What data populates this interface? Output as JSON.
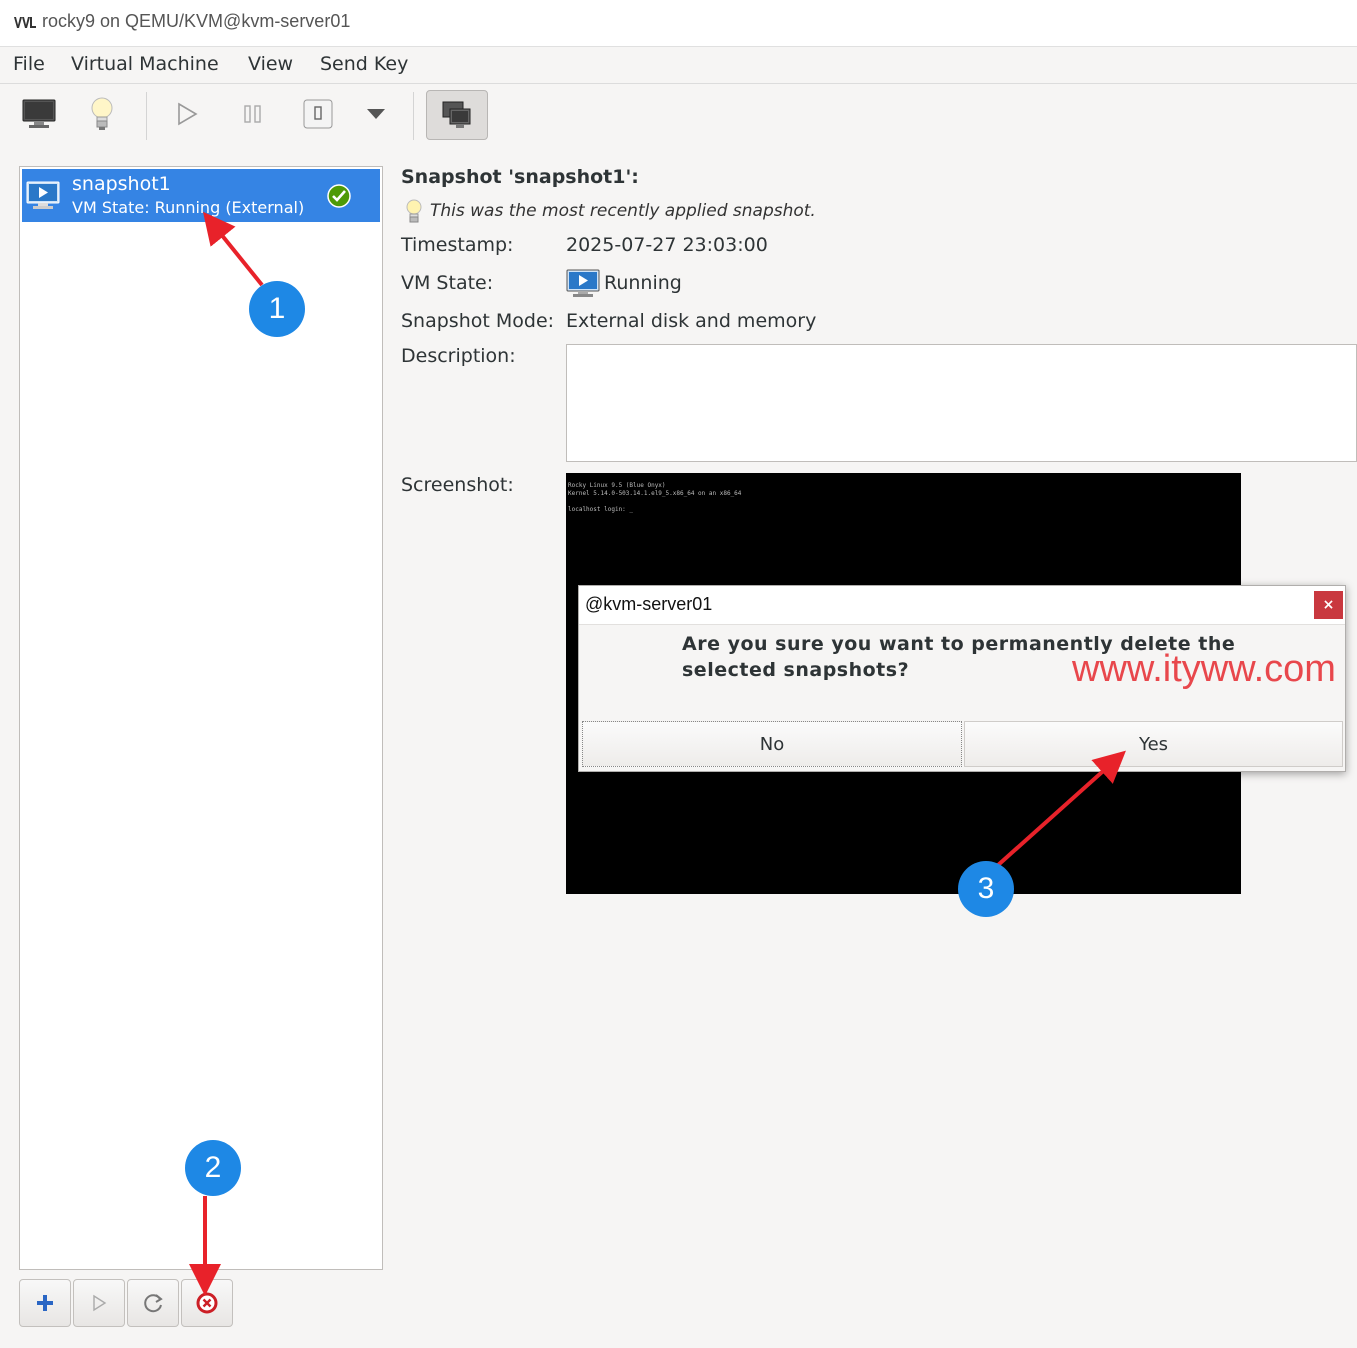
{
  "window": {
    "title": "rocky9 on QEMU/KVM@kvm-server01"
  },
  "menubar": {
    "items": [
      "File",
      "Virtual Machine",
      "View",
      "Send Key"
    ]
  },
  "toolbar": {
    "buttons": [
      "monitor-icon",
      "lightbulb-icon",
      "play-icon",
      "pause-icon",
      "power-icon",
      "dropdown-arrow-icon",
      "snapshots-icon"
    ]
  },
  "snapshot_list": {
    "items": [
      {
        "name": "snapshot1",
        "state": "VM State: Running (External)",
        "current": true
      }
    ]
  },
  "details": {
    "title": "Snapshot 'snapshot1':",
    "recent_note": "This was the most recently applied snapshot.",
    "timestamp_label": "Timestamp:",
    "timestamp_value": "2025-07-27 23:03:00",
    "vmstate_label": "VM State:",
    "vmstate_value": "Running",
    "mode_label": "Snapshot Mode:",
    "mode_value": "External disk and memory",
    "description_label": "Description:",
    "description_value": "",
    "screenshot_label": "Screenshot:",
    "console_lines": "Rocky Linux 9.5 (Blue Onyx)\nKernel 5.14.0-503.14.1.el9_5.x86_64 on an x86_64\n\nlocalhost login: _"
  },
  "dialog": {
    "title": "@kvm-server01",
    "close_label": "×",
    "message": "Are you sure you want to permanently delete the selected snapshots?",
    "no_label": "No",
    "yes_label": "Yes"
  },
  "watermark": "www.ityww.com",
  "annotations": {
    "badges": [
      "1",
      "2",
      "3"
    ],
    "color": "#1e88e5",
    "arrow_color": "#e8222a"
  },
  "colors": {
    "selection": "#3584e4",
    "dialog_close": "#c9383f"
  }
}
